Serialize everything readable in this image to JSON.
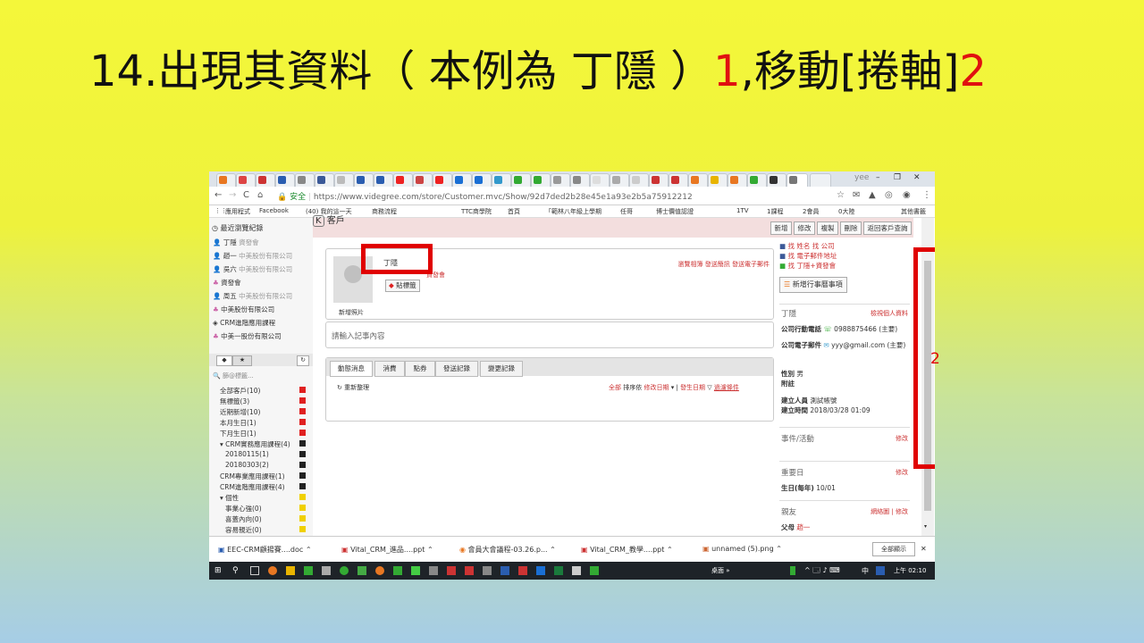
{
  "slide": {
    "title_main": "14.出現其資料（ 本例為 丁隱 ）",
    "title_num1": "1",
    "title_mid": ",移動[捲軸]",
    "title_num2": "2"
  },
  "browser": {
    "url_secure": "安全",
    "url": "https://www.videgree.com/store/Customer.mvc/Show/92d7ded2b28e45e1a93e2b5a75912212",
    "user": "yee",
    "bookmarks": [
      "應用程式",
      "Facebook",
      "(40) 我的這一天",
      "商務流程",
      "TTC商學院",
      "首頁",
      "「範林八年級上學期",
      "任哥",
      "博士價值認證",
      "1TV",
      "1課程",
      "2會員",
      "0大陸",
      "其他書籤"
    ]
  },
  "sidebar": {
    "header": "最近瀏覽紀錄",
    "recent": [
      {
        "name": "丁隱",
        "sub": "資發會"
      },
      {
        "name": "趙一",
        "sub": "中美股份有限公司"
      },
      {
        "name": "吳六",
        "sub": "中美股份有限公司"
      },
      {
        "name": "資發會",
        "sub": ""
      },
      {
        "name": "周五",
        "sub": "中美股份有限公司"
      },
      {
        "name": "中美股份有限公司",
        "sub": ""
      },
      {
        "name": "CRM進階應用課程",
        "sub": ""
      },
      {
        "name": "中美一股份有限公司",
        "sub": ""
      }
    ],
    "search_placeholder": "篩@標籤...",
    "filters": [
      {
        "label": "全部客戶(10)",
        "color": "#e02020"
      },
      {
        "label": "無標籤(3)",
        "color": "#e02020"
      },
      {
        "label": "近期新增(10)",
        "color": "#e02020"
      },
      {
        "label": "本月生日(1)",
        "color": "#e02020"
      },
      {
        "label": "下月生日(1)",
        "color": "#e02020"
      },
      {
        "label": "▾ CRM實務應用課程(4)",
        "color": "#222222"
      },
      {
        "label": "20180115(1)",
        "color": "#222222"
      },
      {
        "label": "20180303(2)",
        "color": "#222222"
      },
      {
        "label": "CRM專業應用課程(1)",
        "color": "#222222"
      },
      {
        "label": "CRM進階應用課程(4)",
        "color": "#222222"
      },
      {
        "label": "▾ 個性",
        "color": "#f0d000"
      },
      {
        "label": "事業心強(0)",
        "color": "#f0d000"
      },
      {
        "label": "喜蓋內向(0)",
        "color": "#f0d000"
      },
      {
        "label": "容易親近(0)",
        "color": "#f0d000"
      }
    ]
  },
  "header": {
    "page_label": "客戶",
    "buttons": [
      "新增",
      "修改",
      "複製",
      "刪除",
      "返回客戶查詢"
    ]
  },
  "profile": {
    "name": "丁隱",
    "company": "資發會",
    "tag_button": "貼標籤",
    "new_photo": "新增照片",
    "links": "瀏覽相簿 發送簡訊 發送電子郵件",
    "note_placeholder": "請輸入記事內容",
    "tabs": [
      "動態消息",
      "消費",
      "點券",
      "發送記錄",
      "變更記錄"
    ],
    "refresh": "重新整理",
    "sort_all": "全部",
    "sort_by": "排序依",
    "sort_field": "修改日期",
    "sort_birthday": "發生日期",
    "sort_filter": "過濾條件"
  },
  "right_panel": {
    "find_name": "找 姓名",
    "find_company": "找 公司",
    "find_email": "找 電子郵件地址",
    "find_other": "找 丁隱+資發會",
    "add_event": "新增行事曆事項",
    "person_name": "丁隱",
    "view_personal": "檢視個人資料",
    "mobile_label": "公司行動電話",
    "mobile_value": "0988875466 (主要)",
    "email_label": "公司電子郵件",
    "email_value": "yyy@gmail.com (主要)",
    "gender_label": "性別",
    "gender_value": "男",
    "note_label": "附註",
    "creator_label": "建立人員",
    "creator_value": "測試帳號",
    "created_label": "建立時間",
    "created_value": "2018/03/28 01:09",
    "events_label": "事件/活動",
    "edit": "修改",
    "important_label": "重要日",
    "birthday_label": "生日(每年)",
    "birthday_value": "10/01",
    "relatives_label": "親友",
    "network": "網絡圖",
    "parent_label": "父母",
    "parent_value": "趙一"
  },
  "downloads": {
    "items": [
      "EEC-CRM顧揚賽....doc",
      "Vital_CRM_進品....ppt",
      "會員大會議程-03.26.p...",
      "Vital_CRM_教學....ppt",
      "unnamed (5).png"
    ],
    "show_all": "全部顯示"
  },
  "taskbar": {
    "desktop": "桌面",
    "lang": "中",
    "time": "上午 02:10"
  },
  "annotations": {
    "label2": "2"
  }
}
